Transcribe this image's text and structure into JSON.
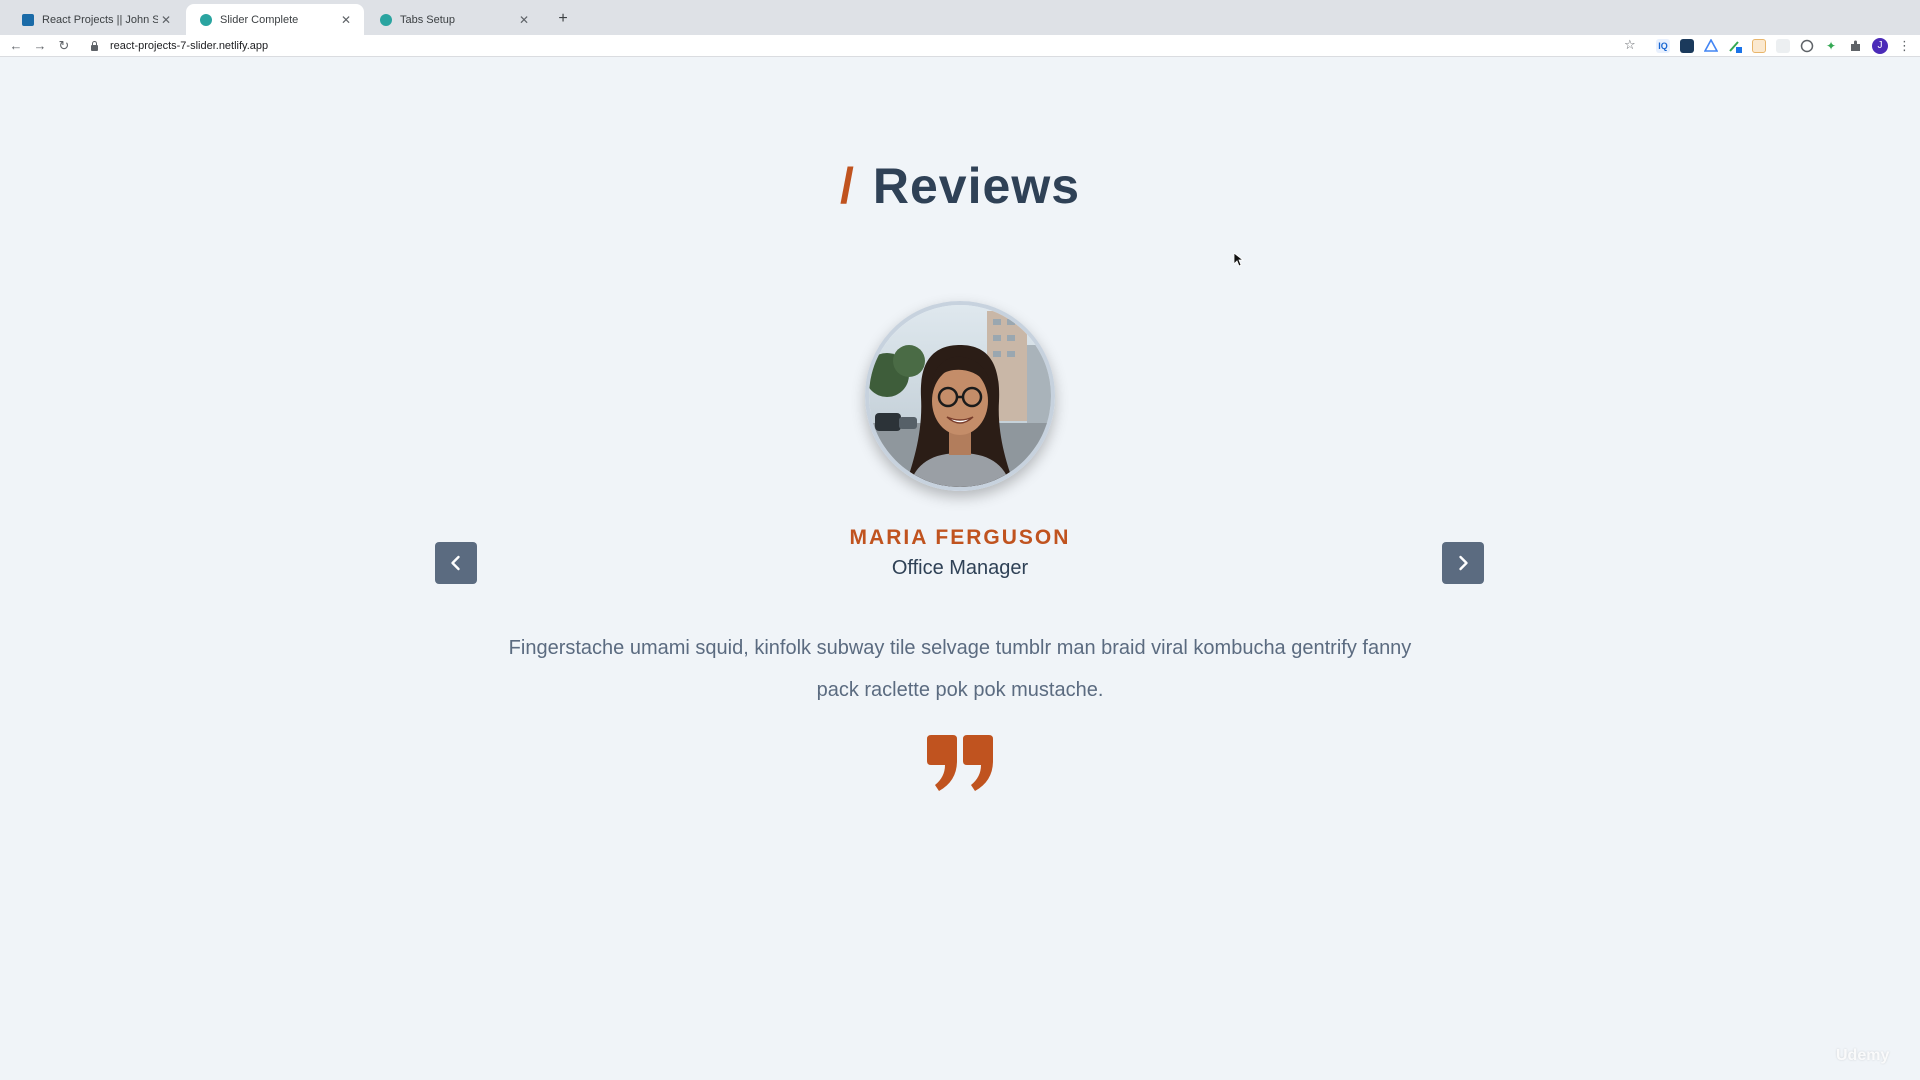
{
  "browser": {
    "tabs": [
      {
        "title": "React Projects || John Smilga",
        "favicon_color": "#1a6ba8",
        "active": false
      },
      {
        "title": "Slider Complete",
        "favicon_color": "#2aa4a0",
        "active": true
      },
      {
        "title": "Tabs Setup",
        "favicon_color": "#2aa4a0",
        "active": false
      }
    ],
    "new_tab_label": "+",
    "url": "react-projects-7-slider.netlify.app",
    "profile_initial": "J",
    "extension_icons": [
      "iq-icon",
      "square-extension-icon",
      "drive-icon",
      "pen-extension-icon",
      "calendar-extension-icon",
      "puzzle-piece-icon-1",
      "shield-extension-icon",
      "leaf-extension-icon",
      "puzzle-icon"
    ]
  },
  "page": {
    "heading_slash": "/",
    "heading": "Reviews",
    "review": {
      "name": "MARIA FERGUSON",
      "title": "Office Manager",
      "text": "Fingerstache umami squid, kinfolk subway tile selvage tumblr man braid viral kombucha gentrify fanny pack raclette pok pok mustache."
    },
    "prev_icon": "chevron-left-icon",
    "next_icon": "chevron-right-icon",
    "quote_icon": "quote-icon"
  },
  "colors": {
    "accent": "#c0531f",
    "heading": "#2f4156",
    "body_text": "#5b6b80",
    "background": "#f0f4f8",
    "button_bg": "#5b6b80"
  },
  "watermark": "Udemy"
}
